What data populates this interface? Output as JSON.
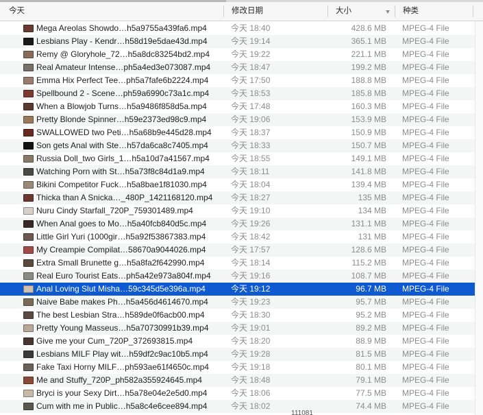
{
  "columns": {
    "name": "今天",
    "date": "修改日期",
    "size": "大小",
    "kind": "种类"
  },
  "colors": {
    "selection": "#0f59d1",
    "alt_row": "#f4f5f5",
    "secondary_text": "#8c8c8c"
  },
  "rows": [
    {
      "name": "Mega Areolas Showdo…h5a9755a439fa6.mp4",
      "date": "今天 18:40",
      "size": "428.6 MB",
      "kind": "MPEG-4 File",
      "thumb": "#6b3a32"
    },
    {
      "name": "Lesbians Play - Kendr…h58d19e5dae43d.mp4",
      "date": "今天 19:14",
      "size": "365.1 MB",
      "kind": "MPEG-4 File",
      "thumb": "#1a1a1a"
    },
    {
      "name": "Remy @ Gloryhole_72…h5a8dc83254bd2.mp4",
      "date": "今天 19:22",
      "size": "221.1 MB",
      "kind": "MPEG-4 File",
      "thumb": "#8a6a58"
    },
    {
      "name": "Real Amateur Intense…ph5a4ed3e073087.mp4",
      "date": "今天 18:47",
      "size": "199.2 MB",
      "kind": "MPEG-4 File",
      "thumb": "#7a6e68"
    },
    {
      "name": "Emma Hix Perfect Tee…ph5a7fafe6b2224.mp4",
      "date": "今天 17:50",
      "size": "188.8 MB",
      "kind": "MPEG-4 File",
      "thumb": "#9a7c70"
    },
    {
      "name": "Spellbound 2 - Scene…ph59a6990c73a1c.mp4",
      "date": "今天 18:53",
      "size": "185.8 MB",
      "kind": "MPEG-4 File",
      "thumb": "#7a3a30"
    },
    {
      "name": "When a Blowjob Turns…h5a9486f858d5a.mp4",
      "date": "今天 17:48",
      "size": "160.3 MB",
      "kind": "MPEG-4 File",
      "thumb": "#5a3a2e"
    },
    {
      "name": "Pretty Blonde Spinner…h59e2373ed98c9.mp4",
      "date": "今天 19:06",
      "size": "153.9 MB",
      "kind": "MPEG-4 File",
      "thumb": "#9a7a5a"
    },
    {
      "name": "SWALLOWED two Peti…h5a68b9e445d28.mp4",
      "date": "今天 18:37",
      "size": "150.9 MB",
      "kind": "MPEG-4 File",
      "thumb": "#6a2a22"
    },
    {
      "name": "Son gets Anal with Ste…h57da6ca8c7405.mp4",
      "date": "今天 18:33",
      "size": "150.7 MB",
      "kind": "MPEG-4 File",
      "thumb": "#111111"
    },
    {
      "name": "Russia Doll_two Girls_1…h5a10d7a41567.mp4",
      "date": "今天 18:55",
      "size": "149.1 MB",
      "kind": "MPEG-4 File",
      "thumb": "#8a7a6a"
    },
    {
      "name": "Watching Porn with St…h5a73f8c84d1a9.mp4",
      "date": "今天 18:11",
      "size": "141.8 MB",
      "kind": "MPEG-4 File",
      "thumb": "#4a4a44"
    },
    {
      "name": "Bikini Competitor Fuck…h5a8bae1f81030.mp4",
      "date": "今天 18:04",
      "size": "139.4 MB",
      "kind": "MPEG-4 File",
      "thumb": "#9a8a7a"
    },
    {
      "name": "Thicka than A Snicka…_480P_1421168120.mp4",
      "date": "今天 18:27",
      "size": "135 MB",
      "kind": "MPEG-4 File",
      "thumb": "#6a3a30"
    },
    {
      "name": "Nuru Cindy Starfall_720P_759301489.mp4",
      "date": "今天 19:10",
      "size": "134 MB",
      "kind": "MPEG-4 File",
      "thumb": "#d8d0c8"
    },
    {
      "name": "When Anal goes to Mo…h5a40fcb840d5c.mp4",
      "date": "今天 19:26",
      "size": "131.1 MB",
      "kind": "MPEG-4 File",
      "thumb": "#3a2a26"
    },
    {
      "name": "Little Girl Yuri (1000gir…h5a92f53867383.mp4",
      "date": "今天 18:42",
      "size": "131 MB",
      "kind": "MPEG-4 File",
      "thumb": "#6a5a50"
    },
    {
      "name": "My Creampie Compilat…58670a9044026.mp4",
      "date": "今天 17:57",
      "size": "128.6 MB",
      "kind": "MPEG-4 File",
      "thumb": "#a04a4a"
    },
    {
      "name": "Extra Small Brunette g…h5a8fa2f642990.mp4",
      "date": "今天 18:14",
      "size": "115.2 MB",
      "kind": "MPEG-4 File",
      "thumb": "#5a4a3e"
    },
    {
      "name": "Real Euro Tourist Eats…ph5a42e973a804f.mp4",
      "date": "今天 19:16",
      "size": "108.7 MB",
      "kind": "MPEG-4 File",
      "thumb": "#8a8a82"
    },
    {
      "name": "Anal Loving Slut Misha…59c345d5e396a.mp4",
      "date": "今天 19:12",
      "size": "96.7 MB",
      "kind": "MPEG-4 File",
      "thumb": "#d0c0b0",
      "selected": true
    },
    {
      "name": "Naive Babe makes Ph…h5a456d4614670.mp4",
      "date": "今天 19:23",
      "size": "95.7 MB",
      "kind": "MPEG-4 File",
      "thumb": "#7a6a5a"
    },
    {
      "name": "The best Lesbian Stra…h589de0f6acb00.mp4",
      "date": "今天 18:30",
      "size": "95.2 MB",
      "kind": "MPEG-4 File",
      "thumb": "#5a4a44"
    },
    {
      "name": "Pretty Young Masseus…h5a70730991b39.mp4",
      "date": "今天 19:01",
      "size": "89.2 MB",
      "kind": "MPEG-4 File",
      "thumb": "#b8a898"
    },
    {
      "name": "Give me your Cum_720P_372693815.mp4",
      "date": "今天 18:20",
      "size": "88.9 MB",
      "kind": "MPEG-4 File",
      "thumb": "#4a3630"
    },
    {
      "name": "Lesbians MILF Play wit…h59df2c9ac10b5.mp4",
      "date": "今天 19:28",
      "size": "81.5 MB",
      "kind": "MPEG-4 File",
      "thumb": "#3a3a3a"
    },
    {
      "name": "Fake Taxi Horny MILF…ph593ae61f4650c.mp4",
      "date": "今天 19:18",
      "size": "80.1 MB",
      "kind": "MPEG-4 File",
      "thumb": "#6a6058"
    },
    {
      "name": "Me and Stuffy_720P_ph582a355924645.mp4",
      "date": "今天 18:48",
      "size": "79.1 MB",
      "kind": "MPEG-4 File",
      "thumb": "#8a4a3a"
    },
    {
      "name": "Bryci is your Sexy Dirt…h5a78e04e2e5d0.mp4",
      "date": "今天 18:06",
      "size": "77.5 MB",
      "kind": "MPEG-4 File",
      "thumb": "#c8b8a8"
    },
    {
      "name": "Cum with me in Public…h5a8c4e6cee894.mp4",
      "date": "今天 18:02",
      "size": "74.4 MB",
      "kind": "MPEG-4 File",
      "thumb": "#5a5650"
    }
  ],
  "bottom_partial": "111081"
}
